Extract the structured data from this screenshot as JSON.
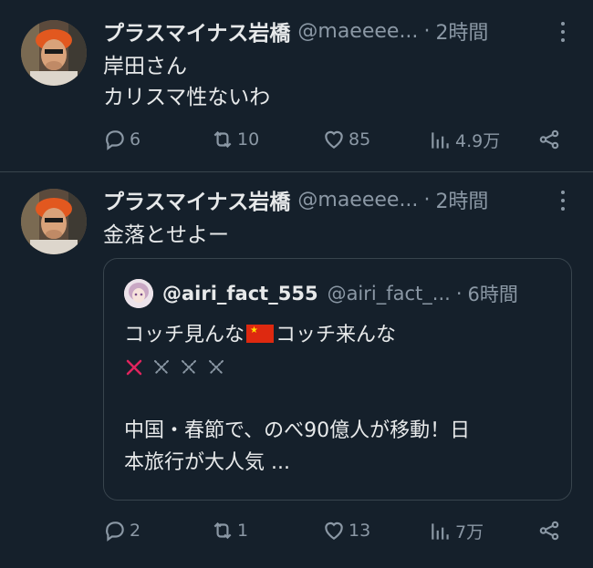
{
  "tweets": [
    {
      "name": "プラスマイナス岩橋",
      "handle": "@maeeee...",
      "separator": "·",
      "time": "2時間",
      "lines": [
        "岸田さん",
        "カリスマ性ないわ"
      ],
      "replies": "6",
      "retweets": "10",
      "likes": "85",
      "views": "4.9万"
    },
    {
      "name": "プラスマイナス岩橋",
      "handle": "@maeeee...",
      "separator": "·",
      "time": "2時間",
      "lines": [
        "金落とせよー"
      ],
      "quote": {
        "name": "@airi_fact_555",
        "handle": "@airi_fact_...",
        "separator": "·",
        "time": "6時間",
        "line1_before_flag": "コッチ見んな",
        "flag_icon": "china-flag-icon",
        "line1_after_flag": "コッチ来んな",
        "line3": "中国・春節で、のべ90億人が移動！日",
        "line4": "本旅行が大人気 ..."
      },
      "replies": "2",
      "retweets": "1",
      "likes": "13",
      "views": "7万"
    }
  ],
  "colors": {
    "background": "#15202b",
    "text": "#e7e9ea",
    "muted": "#8b98a5",
    "border": "#38444d",
    "cross_red": "#e0245e"
  }
}
